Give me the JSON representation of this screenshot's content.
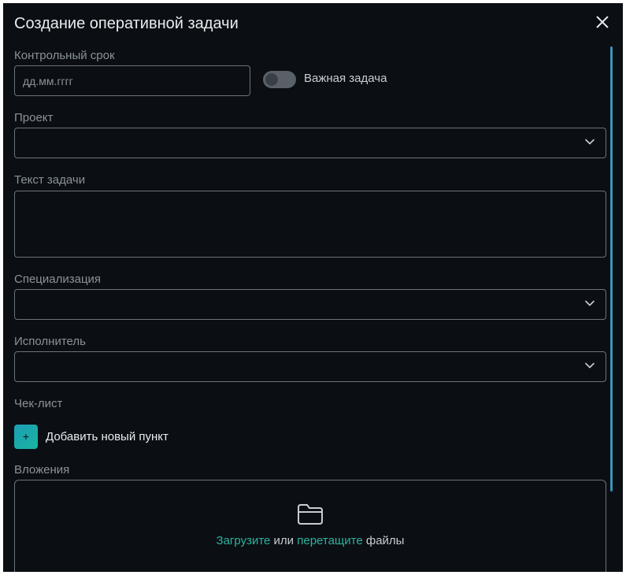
{
  "dialog": {
    "title": "Создание оперативной задачи"
  },
  "deadline": {
    "label": "Контрольный срок",
    "placeholder": "дд.мм.гггг",
    "value": ""
  },
  "important": {
    "label": "Важная задача",
    "checked": false
  },
  "project": {
    "label": "Проект",
    "value": ""
  },
  "task_text": {
    "label": "Текст задачи",
    "value": ""
  },
  "specialization": {
    "label": "Специализация",
    "value": ""
  },
  "assignee": {
    "label": "Исполнитель",
    "value": ""
  },
  "checklist": {
    "label": "Чек-лист",
    "add_icon": "+",
    "add_label": "Добавить новый пункт"
  },
  "attachments": {
    "label": "Вложения",
    "upload_link": "Загрузите",
    "or_text": " или ",
    "drag_link": "перетащите",
    "files_text": " файлы"
  },
  "colors": {
    "background": "#0b0f14",
    "accent": "#2bb3a0",
    "scrollbar": "#3a93b8"
  }
}
